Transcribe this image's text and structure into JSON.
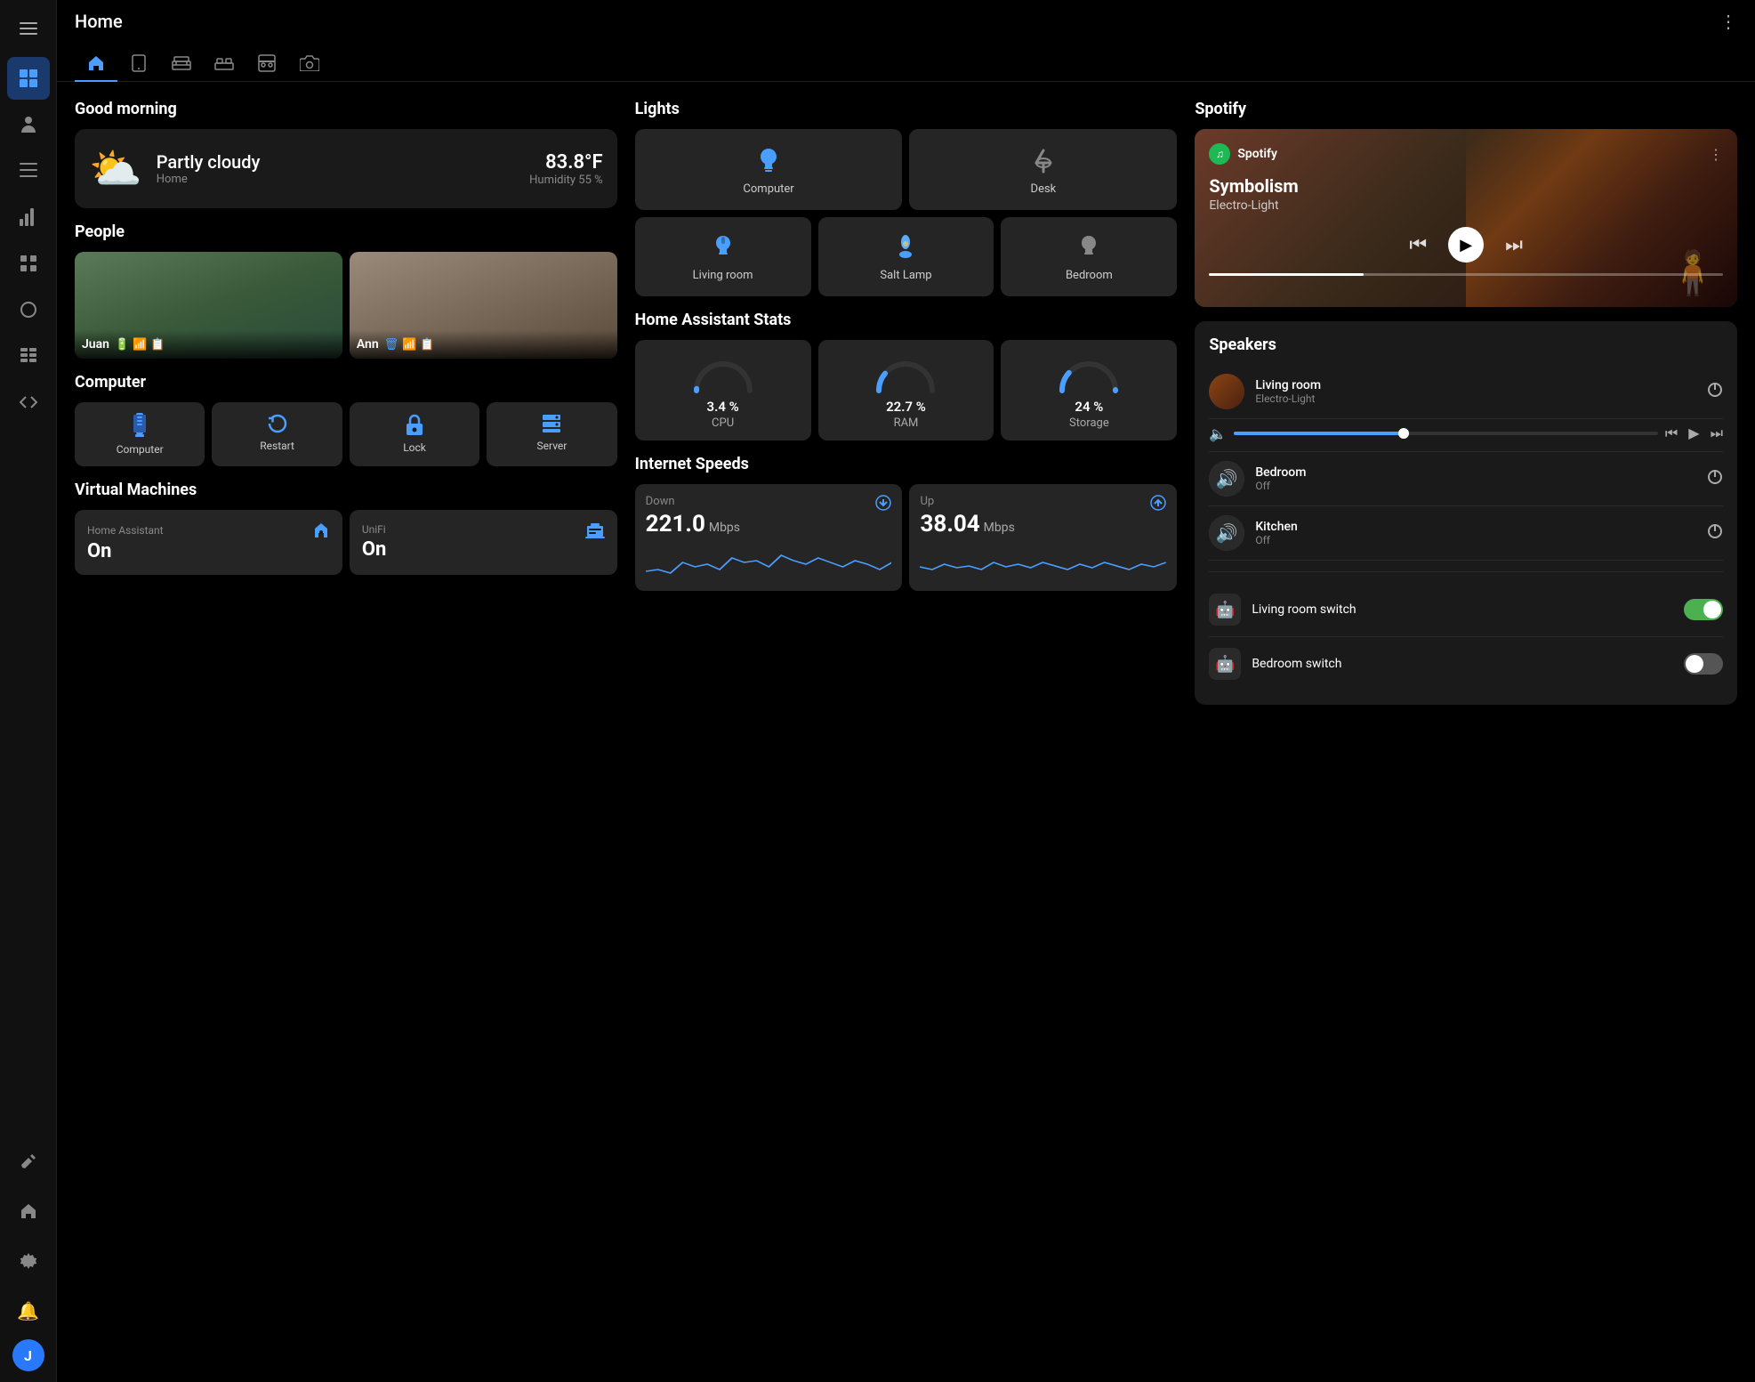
{
  "topbar": {
    "title": "Home",
    "menu_icon": "⋮"
  },
  "sidebar": {
    "items": [
      {
        "id": "dashboard",
        "icon": "⊞",
        "active": true
      },
      {
        "id": "person",
        "icon": "👤",
        "active": false
      },
      {
        "id": "list",
        "icon": "☰",
        "active": false
      },
      {
        "id": "chart",
        "icon": "📊",
        "active": false
      },
      {
        "id": "grid",
        "icon": "▦",
        "active": false
      },
      {
        "id": "circle",
        "icon": "◎",
        "active": false
      },
      {
        "id": "server",
        "icon": "🗄",
        "active": false
      },
      {
        "id": "code",
        "icon": "◁▷",
        "active": false
      }
    ],
    "bottom": [
      {
        "id": "wrench",
        "icon": "🔧"
      },
      {
        "id": "home",
        "icon": "⌂"
      },
      {
        "id": "settings",
        "icon": "⚙"
      }
    ],
    "avatar_label": "J",
    "bell_icon": "🔔"
  },
  "nav_tabs": [
    {
      "id": "home",
      "icon": "⌂",
      "active": true
    },
    {
      "id": "device",
      "icon": "📱",
      "active": false
    },
    {
      "id": "bed1",
      "icon": "🛏",
      "active": false
    },
    {
      "id": "bed2",
      "icon": "🛏",
      "active": false
    },
    {
      "id": "kitchen",
      "icon": "🍽",
      "active": false
    },
    {
      "id": "camera",
      "icon": "📷",
      "active": false
    }
  ],
  "greeting": {
    "title": "Good morning"
  },
  "weather": {
    "condition": "Partly cloudy",
    "location": "Home",
    "temp": "83.8°F",
    "humidity_label": "Humidity",
    "humidity": "55 %"
  },
  "people": {
    "title": "People",
    "persons": [
      {
        "name": "Juan",
        "icons": [
          "🔋",
          "📶",
          "🔖"
        ]
      },
      {
        "name": "Ann",
        "icons": [
          "🗑",
          "📶",
          "🔖"
        ]
      }
    ]
  },
  "computer": {
    "title": "Computer",
    "buttons": [
      {
        "label": "Computer",
        "icon": "💻"
      },
      {
        "label": "Restart",
        "icon": "🔄"
      },
      {
        "label": "Lock",
        "icon": "🔒"
      },
      {
        "label": "Server",
        "icon": "🖥"
      }
    ]
  },
  "virtual_machines": {
    "title": "Virtual Machines",
    "vms": [
      {
        "label": "Home Assistant",
        "status": "On",
        "icon": "🏠"
      },
      {
        "label": "UniFi",
        "status": "On",
        "icon": "🖥"
      }
    ]
  },
  "lights": {
    "title": "Lights",
    "row1": [
      {
        "label": "Computer",
        "icon": "💡",
        "on": true
      },
      {
        "label": "Desk",
        "icon": "🔦",
        "on": false
      }
    ],
    "row2": [
      {
        "label": "Living room",
        "icon": "💡",
        "on": true
      },
      {
        "label": "Salt Lamp",
        "icon": "🕯",
        "on": true
      },
      {
        "label": "Bedroom",
        "icon": "💡",
        "on": false
      }
    ]
  },
  "ha_stats": {
    "title": "Home Assistant Stats",
    "stats": [
      {
        "label": "CPU",
        "value": "3.4 %",
        "percent": 3.4,
        "color": "#4a9eff"
      },
      {
        "label": "RAM",
        "value": "22.7 %",
        "percent": 22.7,
        "color": "#4a9eff"
      },
      {
        "label": "Storage",
        "value": "24 %",
        "percent": 24,
        "color": "#4a9eff"
      }
    ]
  },
  "internet": {
    "title": "Internet Speeds",
    "down": {
      "label": "Down",
      "value": "221.0",
      "unit": "Mbps"
    },
    "up": {
      "label": "Up",
      "value": "38.04",
      "unit": "Mbps"
    }
  },
  "spotify": {
    "title": "Spotify",
    "brand": "Spotify",
    "track": "Symbolism",
    "artist": "Electro-Light",
    "more_icon": "⋮"
  },
  "speakers": {
    "title": "Speakers",
    "items": [
      {
        "name": "Living room",
        "status": "Electro-Light",
        "has_volume": true
      },
      {
        "name": "Bedroom",
        "status": "Off",
        "has_volume": false
      },
      {
        "name": "Kitchen",
        "status": "Off",
        "has_volume": false
      }
    ]
  },
  "switches": {
    "items": [
      {
        "name": "Living room switch",
        "on": true
      },
      {
        "name": "Bedroom switch",
        "on": false
      }
    ]
  }
}
